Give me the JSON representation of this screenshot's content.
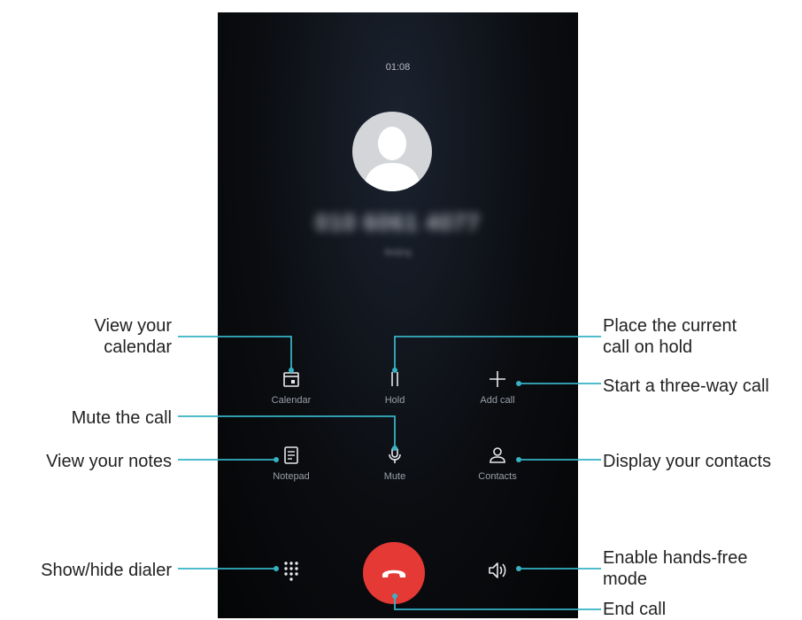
{
  "call": {
    "timer": "01:08",
    "number": "010 6061 4077",
    "location": "Beijing"
  },
  "controls": {
    "calendar": "Calendar",
    "hold": "Hold",
    "add_call": "Add call",
    "notepad": "Notepad",
    "mute": "Mute",
    "contacts": "Contacts"
  },
  "annotations": {
    "calendar_1": "View your",
    "calendar_2": "calendar",
    "hold_1": "Place the current",
    "hold_2": "call on hold",
    "add_call": "Start a three-way call",
    "mute": "Mute the call",
    "notes": "View your notes",
    "contacts": "Display your contacts",
    "dialer": "Show/hide dialer",
    "speaker_1": "Enable hands-free",
    "speaker_2": "mode",
    "end_call": "End call"
  },
  "colors": {
    "leader_line": "#35b2c4",
    "end_call": "#e53935"
  },
  "icons": [
    "calendar-icon",
    "hold-icon",
    "add-icon",
    "notepad-icon",
    "microphone-icon",
    "contacts-icon",
    "dialpad-icon",
    "speaker-icon",
    "end-call-icon"
  ]
}
